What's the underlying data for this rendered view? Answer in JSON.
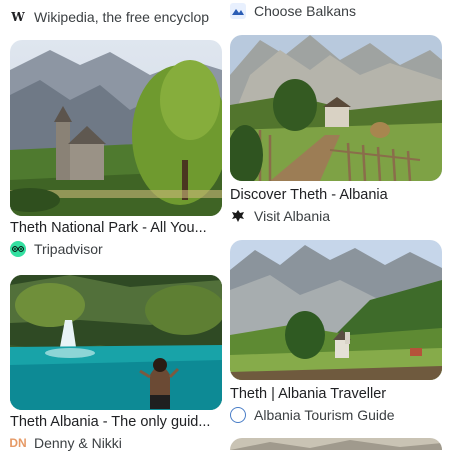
{
  "left": {
    "top_source": {
      "icon": "wikipedia-icon",
      "name": "Wikipedia, the free encyclop"
    },
    "cards": [
      {
        "title": "Theth National Park - All You...",
        "source": "Tripadvisor",
        "icon": "tripadvisor-icon"
      },
      {
        "title": "Theth Albania - The only guid...",
        "source": "Denny & Nikki",
        "icon_text": "DN",
        "icon": "denny-nikki-icon"
      }
    ]
  },
  "right": {
    "top_source": {
      "icon": "choose-balkans-icon",
      "name": "Choose Balkans"
    },
    "cards": [
      {
        "title": "Discover Theth - Albania",
        "source": "Visit Albania",
        "icon": "eagle-icon"
      },
      {
        "title": "Theth | Albania Traveller",
        "source": "Albania Tourism Guide",
        "icon": "globe-icon"
      }
    ]
  }
}
